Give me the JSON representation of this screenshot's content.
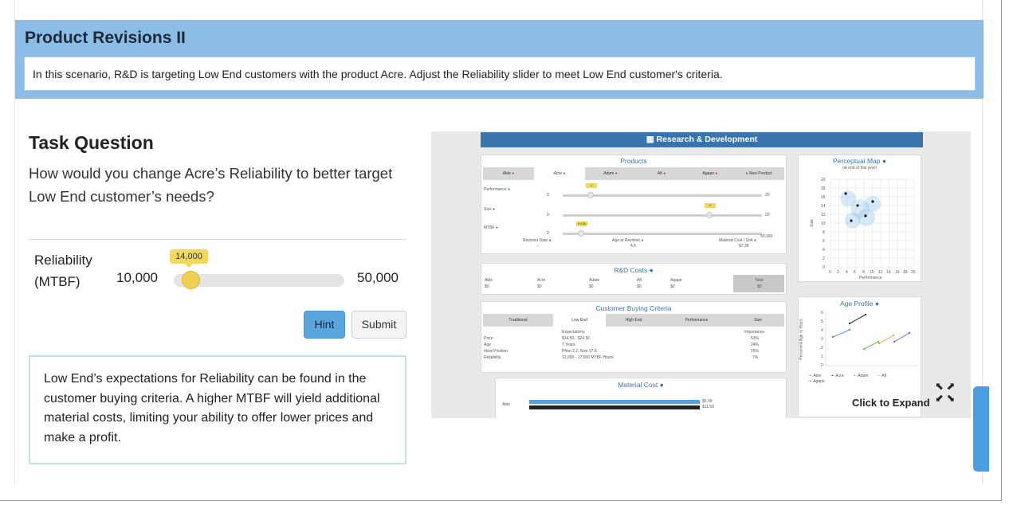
{
  "banner": {
    "title": "Product Revisions II",
    "instruction": "In this scenario, R&D is targeting Low End customers with the product Acre. Adjust the Reliability slider to meet Low End customer's criteria."
  },
  "task": {
    "title": "Task Question",
    "question": "How would you change Acre’s Reliability to better target Low End customer’s needs?"
  },
  "slider": {
    "label_line1": "Reliability",
    "label_line2": "(MTBF)",
    "min_label": "10,000",
    "max_label": "50,000",
    "value_label": "14,000",
    "value": 14000,
    "min": 10000,
    "max": 50000
  },
  "buttons": {
    "hint": "Hint",
    "submit": "Submit"
  },
  "hint_text": "Low End’s expectations for Reliability can be found in the customer buying criteria. A higher MTBF will yield additional material costs, limiting your ability to offer lower prices and make a profit.",
  "preview": {
    "header": "Research & Development",
    "expand_label": "Click to Expand",
    "products": {
      "title": "Products",
      "tabs": [
        "Able",
        "Acre",
        "Adam",
        "Aft",
        "Agape",
        "New Product"
      ],
      "rows": [
        {
          "label": "Performance",
          "min": "0",
          "max": "20",
          "tag": "4"
        },
        {
          "label": "Size",
          "min": "0",
          "max": "20",
          "tag": "17"
        },
        {
          "label": "MTBF",
          "min": "0",
          "max": "50,000",
          "tag": "14,000"
        }
      ],
      "footer": [
        {
          "label": "Revision Date",
          "value": "--"
        },
        {
          "label": "Age at Revision",
          "value": "4.6"
        },
        {
          "label": "Material Cost / Unit",
          "value": "$7.35"
        }
      ]
    },
    "rd_costs": {
      "title": "R&D Costs",
      "names": [
        "Able",
        "Acre",
        "Adam",
        "Aft",
        "Agape",
        "Total"
      ],
      "values": [
        "$0",
        "$0",
        "$0",
        "$0",
        "$0",
        "$0"
      ]
    },
    "criteria": {
      "title": "Customer Buying Criteria",
      "tabs": [
        "Traditional",
        "Low End",
        "High End",
        "Performance",
        "Size"
      ],
      "col_expectations": "Expectations",
      "col_importance": "Importance",
      "rows": [
        {
          "name": "Price",
          "expectation": "$14.50 - $24.50",
          "importance": "53%"
        },
        {
          "name": "Age",
          "expectation": "7 Years",
          "importance": "24%"
        },
        {
          "name": "Ideal Position",
          "expectation": "Pfmn 2.2, Size 17.8",
          "importance": "16%"
        },
        {
          "name": "Reliability",
          "expectation": "12,000 - 17,000 MTBF Hours",
          "importance": "7%"
        }
      ]
    },
    "material_cost": {
      "title": "Material Cost",
      "row_label": "Able",
      "values": [
        "$5.99",
        "$11.59"
      ]
    },
    "perceptual_map": {
      "title": "Perceptual Map",
      "subtitle": "(at end of this year)",
      "xlabel": "Performance",
      "ylabel": "Size",
      "y_ticks": [
        "20",
        "18",
        "16",
        "14",
        "12",
        "10",
        "8",
        "6",
        "4",
        "2",
        "0"
      ],
      "x_ticks": [
        "0",
        "2",
        "4",
        "6",
        "8",
        "10",
        "12",
        "14",
        "16",
        "18",
        "20"
      ]
    },
    "age_profile": {
      "title": "Age Profile",
      "ylabel": "Perceived Age in Years",
      "y_ticks": [
        "6",
        "5",
        "4",
        "3",
        "2",
        "1",
        "0"
      ],
      "legend": [
        "Able",
        "Acre",
        "Adam",
        "Aft",
        "Agape"
      ],
      "colors": [
        "#5b8fd8",
        "#333333",
        "#5cc35c",
        "#f0a040",
        "#7a5fd0"
      ]
    }
  }
}
